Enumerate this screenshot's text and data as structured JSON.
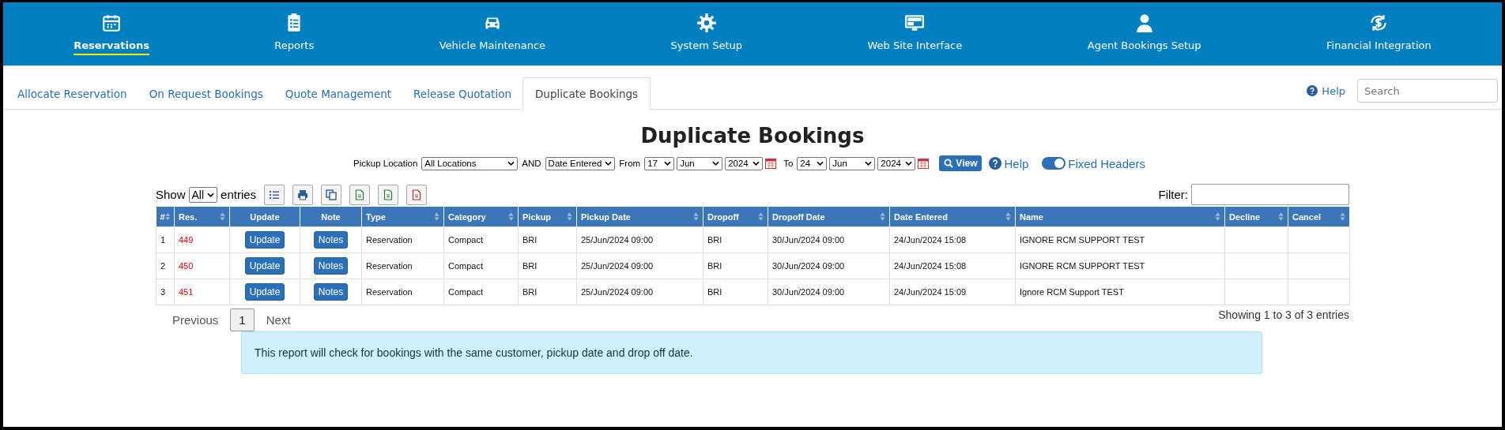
{
  "nav": [
    {
      "label": "Reservations",
      "selected": true
    },
    {
      "label": "Reports",
      "selected": false
    },
    {
      "label": "Vehicle Maintenance",
      "selected": false
    },
    {
      "label": "System Setup",
      "selected": false
    },
    {
      "label": "Web Site Interface",
      "selected": false
    },
    {
      "label": "Agent Bookings Setup",
      "selected": false
    },
    {
      "label": "Financial Integration",
      "selected": false
    }
  ],
  "tabs": [
    {
      "label": "Allocate Reservation",
      "selected": false
    },
    {
      "label": "On Request Bookings",
      "selected": false
    },
    {
      "label": "Quote Management",
      "selected": false
    },
    {
      "label": "Release Quotation",
      "selected": false
    },
    {
      "label": "Duplicate Bookings",
      "selected": true
    }
  ],
  "top_help": "Help",
  "search": {
    "placeholder": "Search"
  },
  "title": "Duplicate Bookings",
  "filters": {
    "pickup_label": "Pickup Location",
    "pickup": "All Locations",
    "and_label": "AND",
    "date_type": "Date Entered",
    "from_label": "From",
    "from": [
      "17",
      "Jun",
      "2024"
    ],
    "to_label": "To",
    "to": [
      "24",
      "Jun",
      "2024"
    ],
    "view": "View",
    "help": "Help",
    "fixed_headers": {
      "label": "Fixed Headers",
      "on": true
    }
  },
  "show_label": "Show",
  "show_value": "All",
  "entries_label": "entries",
  "filter_label": "Filter:",
  "table": {
    "columns": [
      {
        "label": "#",
        "sortable": true
      },
      {
        "label": "Res.",
        "sortable": true
      },
      {
        "label": "Update",
        "sortable": false
      },
      {
        "label": "Note",
        "sortable": false
      },
      {
        "label": "Type",
        "sortable": true
      },
      {
        "label": "Category",
        "sortable": true
      },
      {
        "label": "Pickup",
        "sortable": true
      },
      {
        "label": "Pickup Date",
        "sortable": true
      },
      {
        "label": "Dropoff",
        "sortable": true
      },
      {
        "label": "Dropoff Date",
        "sortable": true
      },
      {
        "label": "Date Entered",
        "sortable": true
      },
      {
        "label": "Name",
        "sortable": true
      },
      {
        "label": "Decline",
        "sortable": true
      },
      {
        "label": "Cancel",
        "sortable": true
      }
    ],
    "rows": [
      {
        "num": "1",
        "res": "449",
        "update": "Update",
        "note": "Notes",
        "type": "Reservation",
        "category": "Compact",
        "pickup": "BRI",
        "pickup_date": "25/Jun/2024 09:00",
        "dropoff": "BRI",
        "dropoff_date": "30/Jun/2024 09:00",
        "date_entered": "24/Jun/2024 15:08",
        "name": "IGNORE RCM SUPPORT TEST"
      },
      {
        "num": "2",
        "res": "450",
        "update": "Update",
        "note": "Notes",
        "type": "Reservation",
        "category": "Compact",
        "pickup": "BRI",
        "pickup_date": "25/Jun/2024 09:00",
        "dropoff": "BRI",
        "dropoff_date": "30/Jun/2024 09:00",
        "date_entered": "24/Jun/2024 15:08",
        "name": "IGNORE RCM SUPPORT TEST"
      },
      {
        "num": "3",
        "res": "451",
        "update": "Update",
        "note": "Notes",
        "type": "Reservation",
        "category": "Compact",
        "pickup": "BRI",
        "pickup_date": "25/Jun/2024 09:00",
        "dropoff": "BRI",
        "dropoff_date": "30/Jun/2024 09:00",
        "date_entered": "24/Jun/2024 15:09",
        "name": "Ignore RCM Support TEST"
      }
    ]
  },
  "pagination": {
    "previous": "Previous",
    "pages": [
      {
        "label": "1",
        "selected": true
      }
    ],
    "next": "Next"
  },
  "info": "Showing 1 to 3 of 3 entries",
  "alert": "This report will check for bookings with the same customer, pickup date and drop off date."
}
